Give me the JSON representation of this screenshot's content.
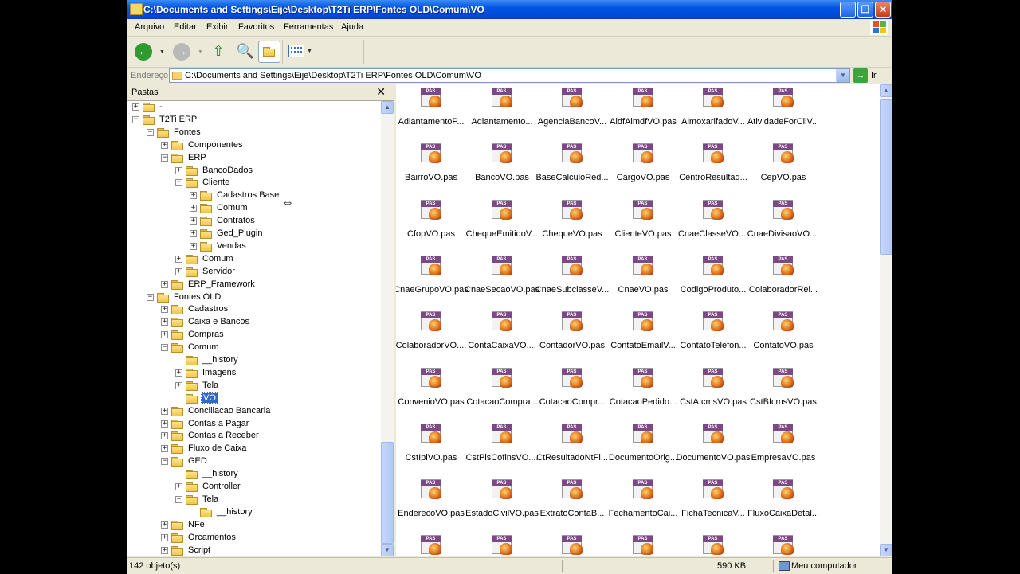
{
  "window": {
    "title": "C:\\Documents and Settings\\Eije\\Desktop\\T2Ti ERP\\Fontes OLD\\Comum\\VO"
  },
  "menu": [
    "Arquivo",
    "Editar",
    "Exibir",
    "Favoritos",
    "Ferramentas",
    "Ajuda"
  ],
  "address": {
    "label": "Endereço",
    "value": "C:\\Documents and Settings\\Eije\\Desktop\\T2Ti ERP\\Fontes OLD\\Comum\\VO",
    "go": "Ir"
  },
  "folders_pane": {
    "title": "Pastas"
  },
  "tree": [
    {
      "label": "-",
      "depth": 0,
      "exp": "+"
    },
    {
      "label": "T2Ti ERP",
      "depth": 0,
      "exp": "-"
    },
    {
      "label": "Fontes",
      "depth": 1,
      "exp": "-"
    },
    {
      "label": "Componentes",
      "depth": 2,
      "exp": "+"
    },
    {
      "label": "ERP",
      "depth": 2,
      "exp": "-"
    },
    {
      "label": "BancoDados",
      "depth": 3,
      "exp": "+"
    },
    {
      "label": "Cliente",
      "depth": 3,
      "exp": "-"
    },
    {
      "label": "Cadastros Base",
      "depth": 4,
      "exp": "+"
    },
    {
      "label": "Comum",
      "depth": 4,
      "exp": "+"
    },
    {
      "label": "Contratos",
      "depth": 4,
      "exp": "+"
    },
    {
      "label": "Ged_Plugin",
      "depth": 4,
      "exp": "+"
    },
    {
      "label": "Vendas",
      "depth": 4,
      "exp": "+"
    },
    {
      "label": "Comum",
      "depth": 3,
      "exp": "+"
    },
    {
      "label": "Servidor",
      "depth": 3,
      "exp": "+"
    },
    {
      "label": "ERP_Framework",
      "depth": 2,
      "exp": "+"
    },
    {
      "label": "Fontes OLD",
      "depth": 1,
      "exp": "-"
    },
    {
      "label": "Cadastros",
      "depth": 2,
      "exp": "+"
    },
    {
      "label": "Caixa e Bancos",
      "depth": 2,
      "exp": "+"
    },
    {
      "label": "Compras",
      "depth": 2,
      "exp": "+"
    },
    {
      "label": "Comum",
      "depth": 2,
      "exp": "-"
    },
    {
      "label": "__history",
      "depth": 3,
      "exp": ""
    },
    {
      "label": "Imagens",
      "depth": 3,
      "exp": "+"
    },
    {
      "label": "Tela",
      "depth": 3,
      "exp": "+"
    },
    {
      "label": "VO",
      "depth": 3,
      "exp": "",
      "selected": true
    },
    {
      "label": "Conciliacao Bancaria",
      "depth": 2,
      "exp": "+"
    },
    {
      "label": "Contas a Pagar",
      "depth": 2,
      "exp": "+"
    },
    {
      "label": "Contas a Receber",
      "depth": 2,
      "exp": "+"
    },
    {
      "label": "Fluxo de Caixa",
      "depth": 2,
      "exp": "+"
    },
    {
      "label": "GED",
      "depth": 2,
      "exp": "-"
    },
    {
      "label": "__history",
      "depth": 3,
      "exp": ""
    },
    {
      "label": "Controller",
      "depth": 3,
      "exp": "+"
    },
    {
      "label": "Tela",
      "depth": 3,
      "exp": "-"
    },
    {
      "label": "__history",
      "depth": 4,
      "exp": ""
    },
    {
      "label": "NFe",
      "depth": 2,
      "exp": "+"
    },
    {
      "label": "Orcamentos",
      "depth": 2,
      "exp": "+"
    },
    {
      "label": "Script",
      "depth": 2,
      "exp": "+"
    }
  ],
  "file_icon_badge": "PAS",
  "files": [
    "AdiantamentoP...",
    "Adiantamento...",
    "AgenciaBancoV...",
    "AidfAimdfVO.pas",
    "AlmoxarifadoV...",
    "AtividadeForCliV...",
    "BairroVO.pas",
    "BancoVO.pas",
    "BaseCalculoRed...",
    "CargoVO.pas",
    "CentroResultad...",
    "CepVO.pas",
    "CfopVO.pas",
    "ChequeEmitidoV...",
    "ChequeVO.pas",
    "ClienteVO.pas",
    "CnaeClasseVO....",
    "CnaeDivisaoVO....",
    "CnaeGrupoVO.pas",
    "CnaeSecaoVO.pas",
    "CnaeSubclasseV...",
    "CnaeVO.pas",
    "CodigoProduto...",
    "ColaboradorRel...",
    "ColaboradorVO....",
    "ContaCaixaVO....",
    "ContadorVO.pas",
    "ContatoEmailV...",
    "ContatoTelefon...",
    "ContatoVO.pas",
    "ConvenioVO.pas",
    "CotacaoCompra...",
    "CotacaoCompr...",
    "CotacaoPedido...",
    "CstAIcmsVO.pas",
    "CstBIcmsVO.pas",
    "CstIpiVO.pas",
    "CstPisCofinsVO....",
    "CtResultadoNtFi...",
    "DocumentoOrig...",
    "DocumentoVO.pas",
    "EmpresaVO.pas",
    "EnderecoVO.pas",
    "EstadoCivilVO.pas",
    "ExtratoContaB...",
    "FechamentoCai...",
    "FichaTecnicaV...",
    "FluxoCaixaDetal...",
    "",
    "",
    "",
    "",
    "",
    ""
  ],
  "status": {
    "count": "142 objeto(s)",
    "size": "590 KB",
    "location": "Meu computador"
  },
  "colors": {
    "titlebar": "#0055e5",
    "selection": "#316ac5",
    "chrome": "#ece9d8"
  }
}
